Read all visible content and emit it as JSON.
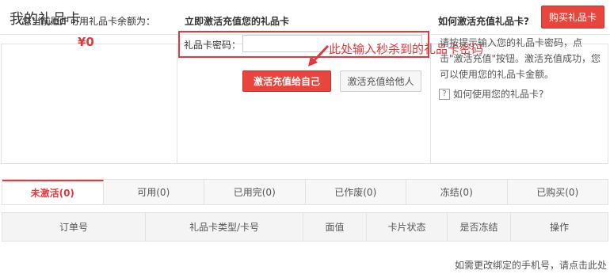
{
  "header": {
    "title": "我的礼品卡",
    "buy_button": "购买礼品卡"
  },
  "balance": {
    "label": "您当前账户可用礼品卡余额为：",
    "value": "¥0"
  },
  "activate": {
    "title": "立即激活充值您的礼品卡",
    "code_label": "礼品卡密码：",
    "code_value": "",
    "code_placeholder": "",
    "self_button": "激活充值给自己",
    "other_button": "激活充值给他人"
  },
  "annotation": {
    "text": "此处输入秒杀到的礼品卡密码",
    "color": "#e0393e"
  },
  "help": {
    "title": "如何激活充值礼品卡?",
    "text": "请按提示输入您的礼品卡密码，点击\"激活充值\"按钮。激活充值成功，您可以使用您的礼品卡金额。",
    "link_icon": "question-icon",
    "link": "如何使用您的礼品卡?"
  },
  "tabs": [
    {
      "label": "未激活(0)",
      "active": true
    },
    {
      "label": "可用(0)",
      "active": false
    },
    {
      "label": "已用完(0)",
      "active": false
    },
    {
      "label": "已作废(0)",
      "active": false
    },
    {
      "label": "冻结(0)",
      "active": false
    },
    {
      "label": "已购买(0)",
      "active": false
    }
  ],
  "table": {
    "columns": [
      "订单号",
      "礼品卡类型/卡号",
      "面值",
      "卡片状态",
      "是否冻结",
      "操作"
    ]
  },
  "footer": {
    "note": "如需更改绑定的手机号，请点击此处"
  },
  "colors": {
    "accent": "#e8453c",
    "active_tab": "#e4393c"
  }
}
